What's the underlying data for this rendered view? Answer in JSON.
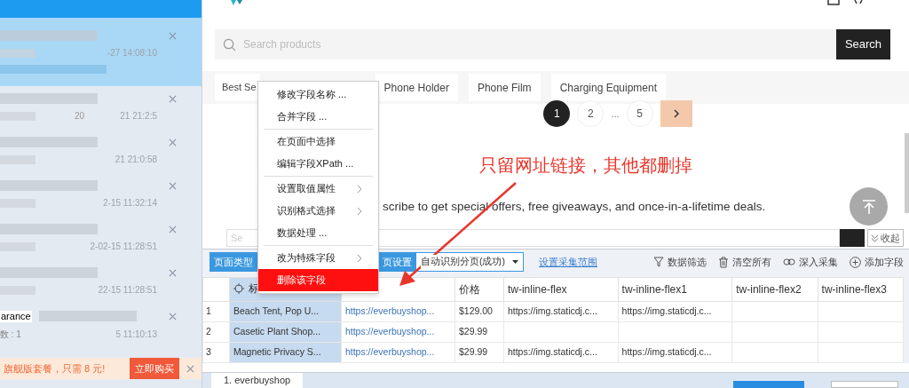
{
  "sidebar": {
    "items": [
      {
        "time": "-27 14:08:10",
        "selected": true
      },
      {
        "fragment": "20",
        "time": "21 21:2:5",
        "selected": false
      },
      {
        "time": "21 21:0:58",
        "selected": false
      },
      {
        "time": "2-15 11:32:14",
        "selected": false
      },
      {
        "time": "2-02-15 11:28:51",
        "selected": false
      },
      {
        "time": "22-15 11:28:51",
        "selected": false
      },
      {
        "time": "5 11:10:13",
        "title": "arance",
        "subtitle": "数 : 1",
        "selected": false
      }
    ],
    "promo": {
      "text": "旗舰版套餐，只需 8 元!",
      "button": "立即购买"
    }
  },
  "store": {
    "search": {
      "placeholder": "Search products",
      "button": "Search"
    },
    "categories": [
      {
        "label": "Best Se"
      },
      {
        "label": "Phone Holder"
      },
      {
        "label": "Phone Film"
      },
      {
        "label": "Charging Equipment"
      }
    ],
    "pagination": [
      {
        "kind": "page",
        "label": "1",
        "selected": true
      },
      {
        "kind": "page",
        "label": "2",
        "selected": false
      },
      {
        "kind": "gap",
        "label": "..."
      },
      {
        "kind": "page",
        "label": "5",
        "selected": false
      },
      {
        "kind": "next"
      }
    ],
    "subscribe_text": "scribe to get special offers, free giveaways, and once-in-a-lifetime deals.",
    "email_placeholder": "Se"
  },
  "annotation": "只留网址链接，其他都删掉",
  "collapse_button": "收起",
  "context_menu": [
    [
      {
        "label": "修改字段名称 ...",
        "submenu": false,
        "selected": false
      },
      {
        "label": "合并字段 ...",
        "submenu": false,
        "selected": false
      }
    ],
    [
      {
        "label": "在页面中选择",
        "submenu": false,
        "selected": false
      },
      {
        "label": "编辑字段XPath ...",
        "submenu": false,
        "selected": false
      }
    ],
    [
      {
        "label": "设置取值属性",
        "submenu": true,
        "selected": false
      },
      {
        "label": "识别格式选择",
        "submenu": true,
        "selected": false
      },
      {
        "label": "数据处理 ...",
        "submenu": false,
        "selected": false
      }
    ],
    [
      {
        "label": "改为特殊字段",
        "submenu": true,
        "selected": false
      },
      {
        "label": "删除该字段",
        "submenu": false,
        "selected": true
      }
    ]
  ],
  "toolbar": {
    "page_type": "页面类型",
    "page_settings": "页设置",
    "pagination_select": "自动识别分页(成功)",
    "range_link": "设置采集范围",
    "actions": [
      {
        "kind": "filter",
        "label": "数据筛选"
      },
      {
        "kind": "clear",
        "label": "清空所有"
      },
      {
        "kind": "deep",
        "label": "深入采集"
      },
      {
        "kind": "add",
        "label": "添加字段"
      }
    ]
  },
  "table": {
    "columns": [
      {
        "kind": "field",
        "label": "标",
        "selected": true
      },
      {
        "kind": "covered",
        "selected": false
      },
      {
        "kind": "field",
        "label": "价格",
        "selected": false
      },
      {
        "kind": "field",
        "label": "tw-inline-flex",
        "selected": false
      },
      {
        "kind": "field",
        "label": "tw-inline-flex1",
        "selected": false
      },
      {
        "kind": "field",
        "label": "tw-inline-flex2",
        "selected": false
      },
      {
        "kind": "field",
        "label": "tw-inline-flex3",
        "selected": false
      }
    ],
    "rows": [
      {
        "index": "1",
        "cells": [
          {
            "kind": "text",
            "text": "Beach Tent, Pop U..."
          },
          {
            "kind": "text",
            "text": "https://everbuyshop..."
          },
          {
            "kind": "text",
            "text": "$129.00"
          },
          {
            "kind": "text",
            "text": "https://img.staticdj.c..."
          },
          {
            "kind": "text",
            "text": "https://img.staticdj.c..."
          },
          {
            "kind": "empty"
          },
          {
            "kind": "empty"
          }
        ]
      },
      {
        "index": "2",
        "cells": [
          {
            "kind": "text",
            "text": "Casetic Plant Shop..."
          },
          {
            "kind": "text",
            "text": "https://everbuyshop..."
          },
          {
            "kind": "text",
            "text": "$29.99"
          },
          {
            "kind": "empty"
          },
          {
            "kind": "empty"
          },
          {
            "kind": "empty"
          },
          {
            "kind": "empty"
          }
        ]
      },
      {
        "index": "3",
        "cells": [
          {
            "kind": "text",
            "text": "Magnetic Privacy S..."
          },
          {
            "kind": "text",
            "text": "https://everbuyshop..."
          },
          {
            "kind": "text",
            "text": "$29.99"
          },
          {
            "kind": "text",
            "text": "https://img.staticdj.c..."
          },
          {
            "kind": "text",
            "text": "https://img.staticdj.c..."
          },
          {
            "kind": "empty"
          },
          {
            "kind": "empty"
          }
        ]
      }
    ]
  },
  "bottom_tabs": [
    {
      "label": "1. everbuyshop",
      "selected": true
    }
  ]
}
